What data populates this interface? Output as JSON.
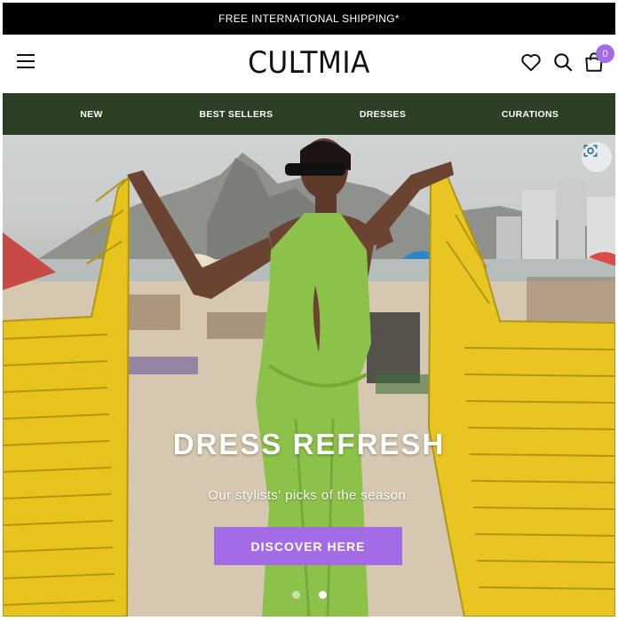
{
  "promo": {
    "text": "FREE INTERNATIONAL SHIPPING*"
  },
  "header": {
    "logo": "CULTMIA",
    "menu_icon": "hamburger-menu-icon",
    "wishlist_icon": "heart-icon",
    "search_icon": "search-icon",
    "cart_icon": "shopping-bag-icon",
    "cart_count": "0"
  },
  "nav": {
    "items": [
      {
        "label": "NEW"
      },
      {
        "label": "BEST SELLERS"
      },
      {
        "label": "DRESSES"
      },
      {
        "label": "CURATIONS"
      }
    ]
  },
  "hero": {
    "title": "DRESS REFRESH",
    "subtitle": "Our stylists' picks of the season.",
    "cta_label": "DISCOVER HERE",
    "lens_icon": "visual-search-icon",
    "slides": {
      "count": 2,
      "active_index": 1
    }
  },
  "colors": {
    "promo_bg": "#000000",
    "nav_bg": "#2a3f23",
    "accent": "#a46be6",
    "dress": "#8dc24a",
    "chairs": "#e8c420"
  }
}
